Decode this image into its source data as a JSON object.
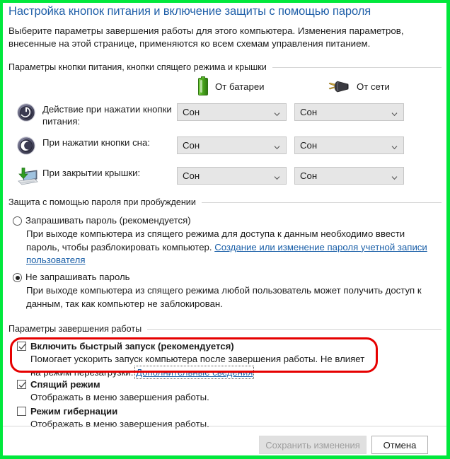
{
  "window": {
    "title": "Настройка кнопок питания и включение защиты с помощью пароля",
    "description": "Выберите параметры завершения работы для этого компьютера. Изменения параметров, внесенные на этой странице, применяются ко всем схемам управления питанием."
  },
  "power_buttons_section": {
    "header": "Параметры кнопки питания, кнопки спящего режима и крышки",
    "columns": [
      {
        "icon": "battery-icon",
        "label": "От батареи"
      },
      {
        "icon": "power-plug-icon",
        "label": "От сети"
      }
    ],
    "rows": [
      {
        "icon": "power-button-icon",
        "label": "Действие при нажатии кнопки питания:",
        "battery_value": "Сон",
        "plugged_value": "Сон"
      },
      {
        "icon": "sleep-button-icon",
        "label": "При нажатии кнопки сна:",
        "battery_value": "Сон",
        "plugged_value": "Сон"
      },
      {
        "icon": "laptop-lid-icon",
        "label": "При закрытии крышки:",
        "battery_value": "Сон",
        "plugged_value": "Сон"
      }
    ]
  },
  "password_section": {
    "header": "Защита с помощью пароля при пробуждении",
    "options": [
      {
        "label": "Запрашивать пароль (рекомендуется)",
        "selected": false,
        "description_before": "При выходе компьютера из спящего режима для доступа к данным необходимо ввести пароль, чтобы разблокировать компьютер. ",
        "link": "Создание или изменение пароля учетной записи пользователя",
        "description_after": ""
      },
      {
        "label": "Не запрашивать пароль",
        "selected": true,
        "description_before": "При выходе компьютера из спящего режима любой пользователь может получить доступ к данным, так как компьютер не заблокирован.",
        "link": "",
        "description_after": ""
      }
    ]
  },
  "shutdown_section": {
    "header": "Параметры завершения работы",
    "items": [
      {
        "label": "Включить быстрый запуск (рекомендуется)",
        "checked": true,
        "description_before": "Помогает ускорить запуск компьютера после завершения работы. Не влияет на режим перезагрузки. ",
        "link": "Дополнительные сведения",
        "highlighted": true
      },
      {
        "label": "Спящий режим",
        "checked": true,
        "description_before": "Отображать в меню завершения работы.",
        "link": "",
        "highlighted": false
      },
      {
        "label": "Режим гибернации",
        "checked": false,
        "description_before": "Отображать в меню завершения работы.",
        "link": "",
        "highlighted": false
      }
    ]
  },
  "footer": {
    "save_label": "Сохранить изменения",
    "cancel_label": "Отмена"
  },
  "colors": {
    "title_blue": "#1f5fa8",
    "link_blue": "#1a5fa8",
    "annotation_red": "#e60000",
    "frame_green": "#00e83c",
    "battery_green": "#4fae20"
  }
}
